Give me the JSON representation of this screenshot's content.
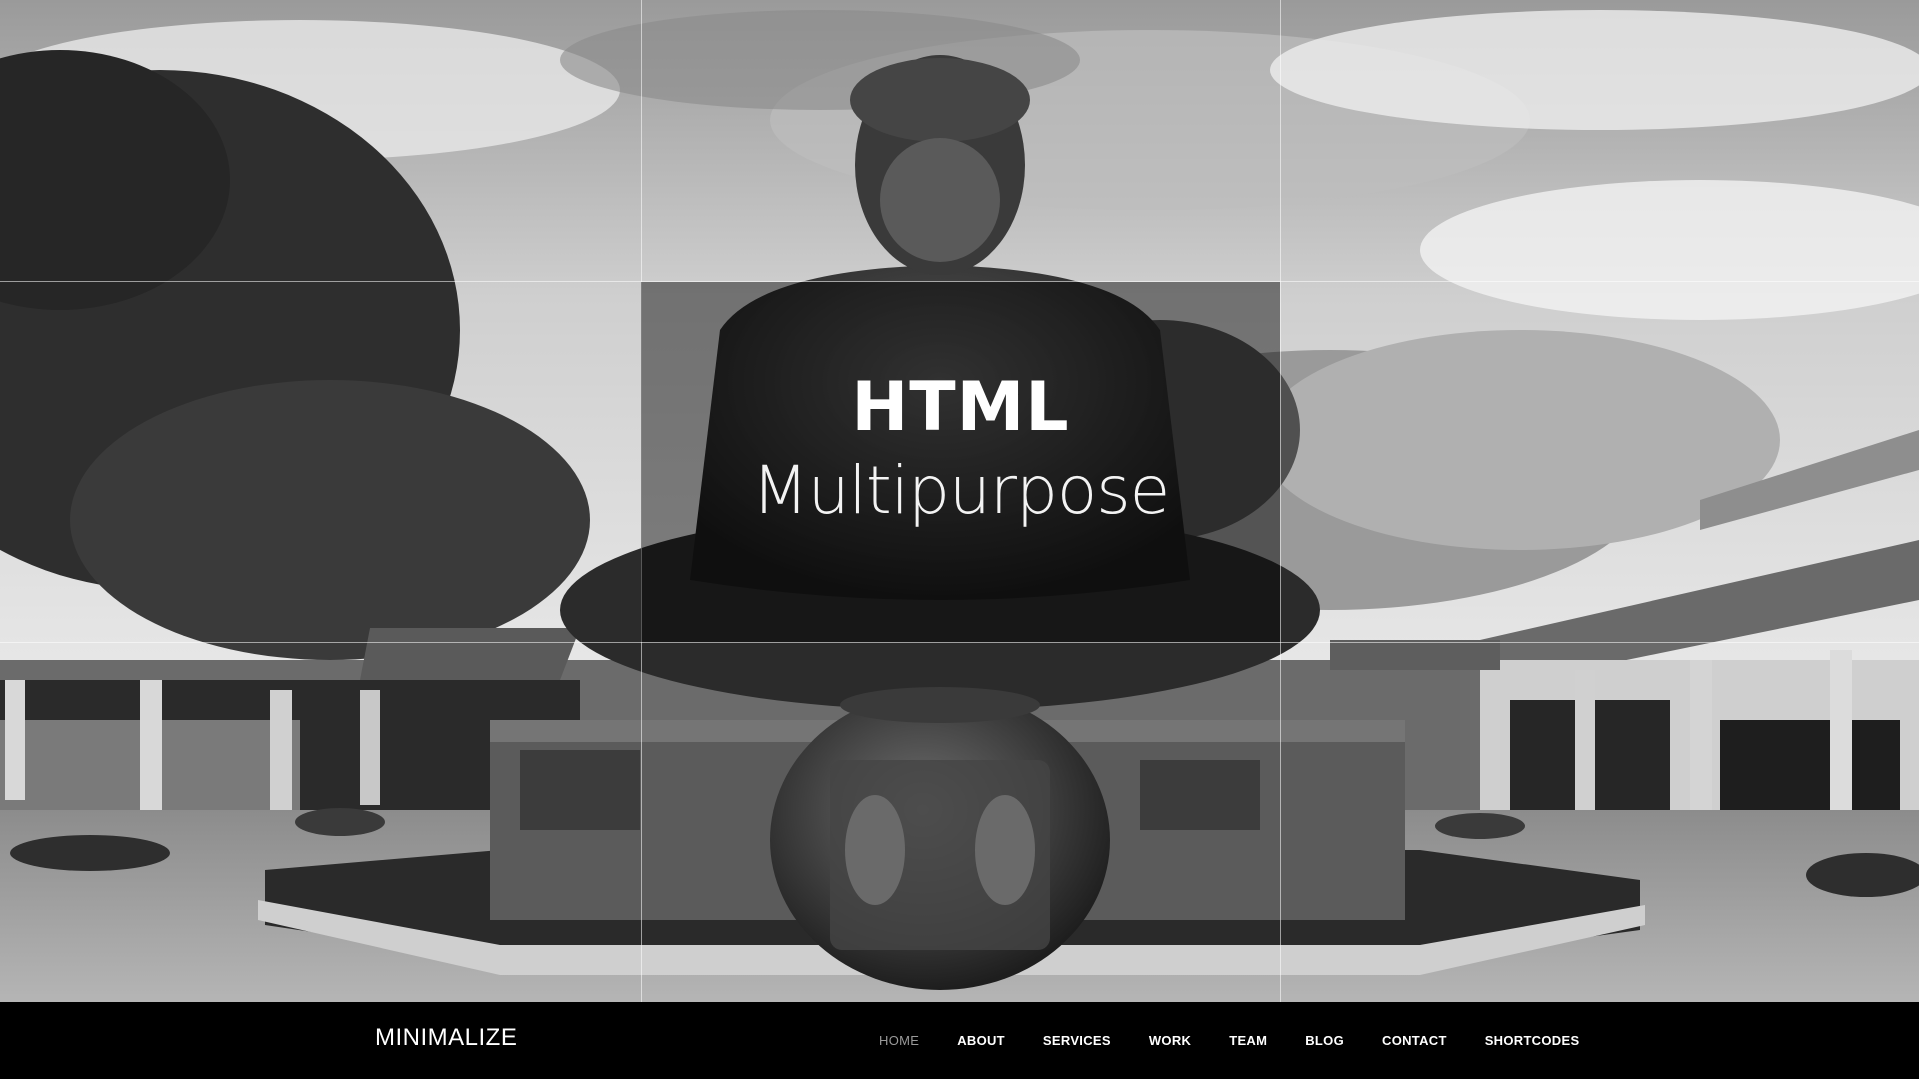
{
  "hero": {
    "title": "HTML",
    "subtitle": "Multipurpose"
  },
  "navbar": {
    "brand": "MINIMALIZE",
    "items": [
      {
        "label": "HOME",
        "active": true
      },
      {
        "label": "ABOUT",
        "active": false
      },
      {
        "label": "SERVICES",
        "active": false
      },
      {
        "label": "WORK",
        "active": false
      },
      {
        "label": "TEAM",
        "active": false
      },
      {
        "label": "BLOG",
        "active": false
      },
      {
        "label": "CONTACT",
        "active": false
      },
      {
        "label": "SHORTCODES",
        "active": false
      }
    ]
  },
  "colors": {
    "navbar_bg": "#000000",
    "nav_text": "#ffffff",
    "nav_active": "#9a9a9a",
    "overlay": "rgba(0,0,0,0.45)"
  }
}
